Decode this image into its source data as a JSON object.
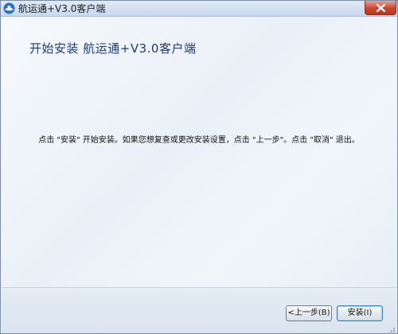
{
  "window": {
    "title": "航运通+V3.0客户端"
  },
  "header": {
    "title": "开始安装 航运通+V3.0客户端"
  },
  "body": {
    "instruction": "点击 \"安装\" 开始安装。如果您想复查或更改安装设置，点击 \"上一步\"。点击 \"取消\" 退出。"
  },
  "buttons": {
    "back_label": "<上一步(B)",
    "install_label": "安装(I)"
  },
  "colors": {
    "title_blue": "#1f3a7a",
    "close_red": "#c8462f"
  }
}
